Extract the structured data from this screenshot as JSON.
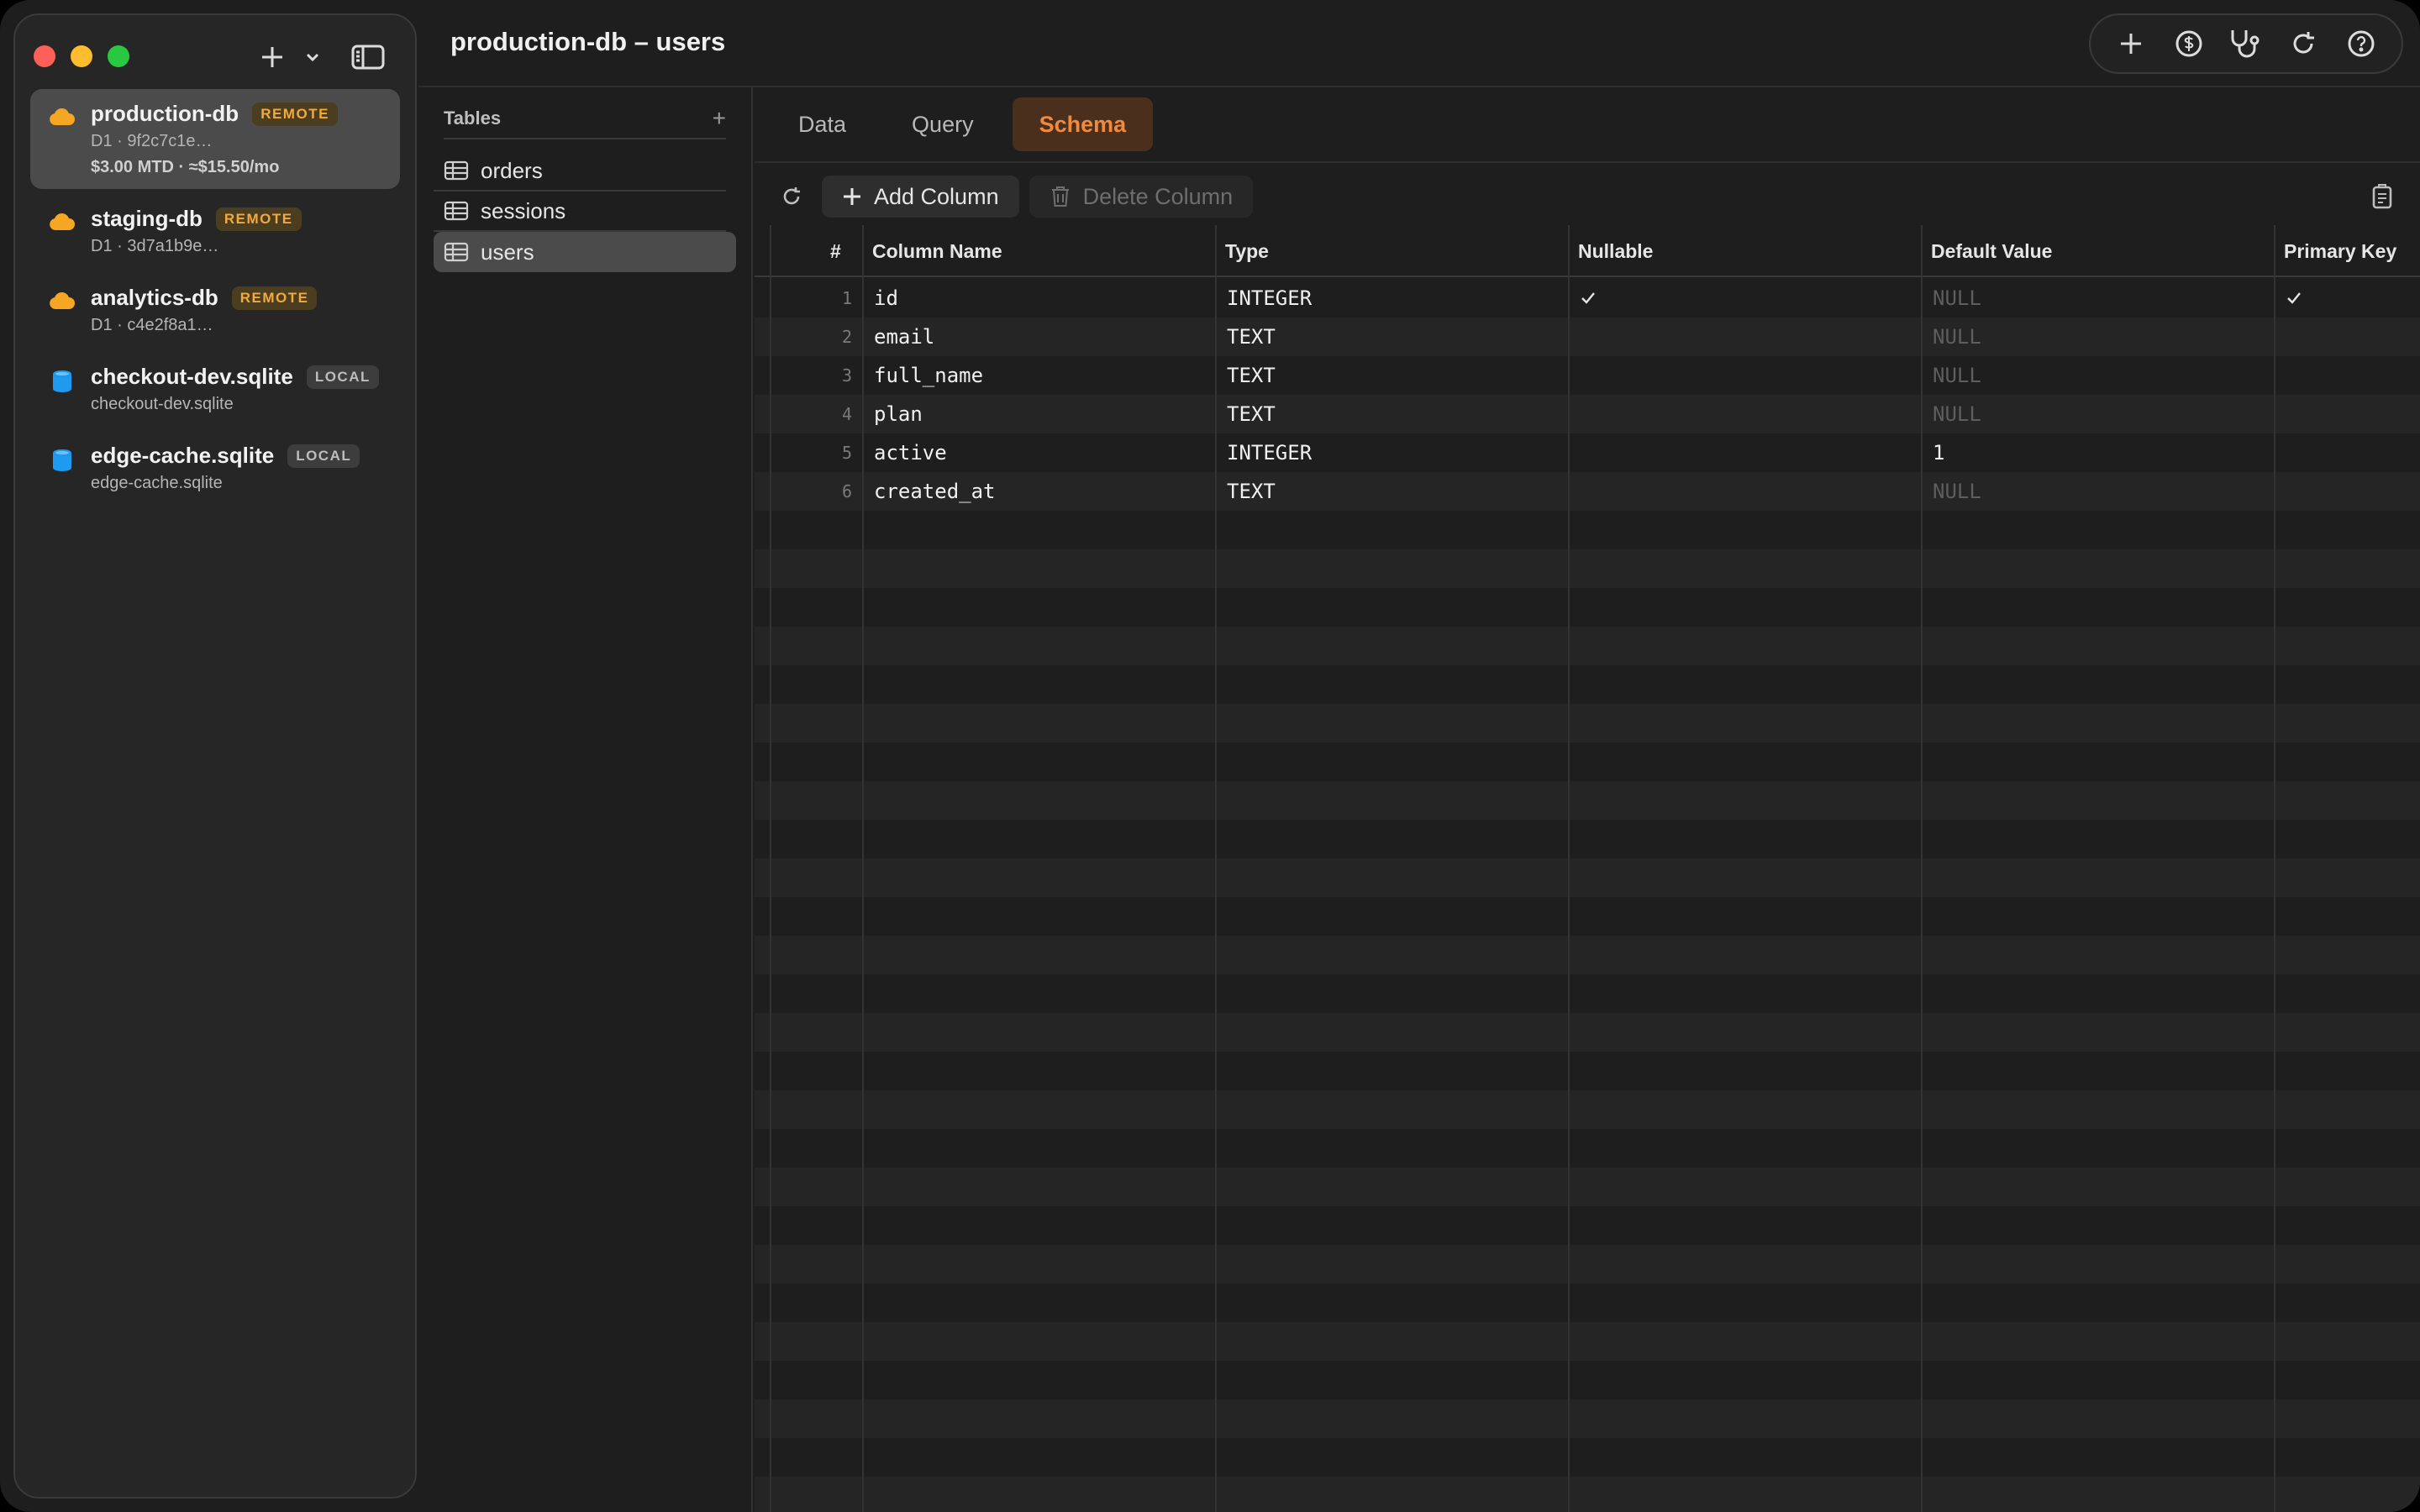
{
  "window": {
    "title": "production-db – users"
  },
  "databases": [
    {
      "name": "production-db",
      "badge": "REMOTE",
      "kind": "remote",
      "sub": "D1 · 9f2c7c1e…",
      "cost": "$3.00 MTD · ≈$15.50/mo",
      "icon": "cloud-icon"
    },
    {
      "name": "staging-db",
      "badge": "REMOTE",
      "kind": "remote",
      "sub": "D1 · 3d7a1b9e…",
      "icon": "cloud-icon"
    },
    {
      "name": "analytics-db",
      "badge": "REMOTE",
      "kind": "remote",
      "sub": "D1 · c4e2f8a1…",
      "icon": "cloud-icon"
    },
    {
      "name": "checkout-dev.sqlite",
      "badge": "LOCAL",
      "kind": "local",
      "sub": "checkout-dev.sqlite",
      "icon": "cylinder-icon"
    },
    {
      "name": "edge-cache.sqlite",
      "badge": "LOCAL",
      "kind": "local",
      "sub": "edge-cache.sqlite",
      "icon": "cylinder-icon"
    }
  ],
  "tables_pane": {
    "header": "Tables",
    "items": [
      "orders",
      "sessions",
      "users"
    ],
    "selected": "users"
  },
  "tabs": [
    {
      "label": "Data",
      "active": false
    },
    {
      "label": "Query",
      "active": false
    },
    {
      "label": "Schema",
      "active": true
    }
  ],
  "actions": {
    "add_column": "Add Column",
    "delete_column": "Delete Column"
  },
  "schema": {
    "columns": [
      "#",
      "Column Name",
      "Type",
      "Nullable",
      "Default Value",
      "Primary Key"
    ],
    "rows": [
      {
        "n": "1",
        "name": "id",
        "type": "INTEGER",
        "nullable": true,
        "default": "NULL",
        "pk": true
      },
      {
        "n": "2",
        "name": "email",
        "type": "TEXT",
        "nullable": false,
        "default": "NULL",
        "pk": false
      },
      {
        "n": "3",
        "name": "full_name",
        "type": "TEXT",
        "nullable": false,
        "default": "NULL",
        "pk": false
      },
      {
        "n": "4",
        "name": "plan",
        "type": "TEXT",
        "nullable": false,
        "default": "NULL",
        "pk": false
      },
      {
        "n": "5",
        "name": "active",
        "type": "INTEGER",
        "nullable": false,
        "default": "1",
        "pk": false
      },
      {
        "n": "6",
        "name": "created_at",
        "type": "TEXT",
        "nullable": false,
        "default": "NULL",
        "pk": false
      }
    ]
  },
  "colors": {
    "accent": "#f08a3c",
    "remote_badge": "#f3a93b",
    "cloud": "#f5a623",
    "cylinder": "#1e9bf0"
  }
}
